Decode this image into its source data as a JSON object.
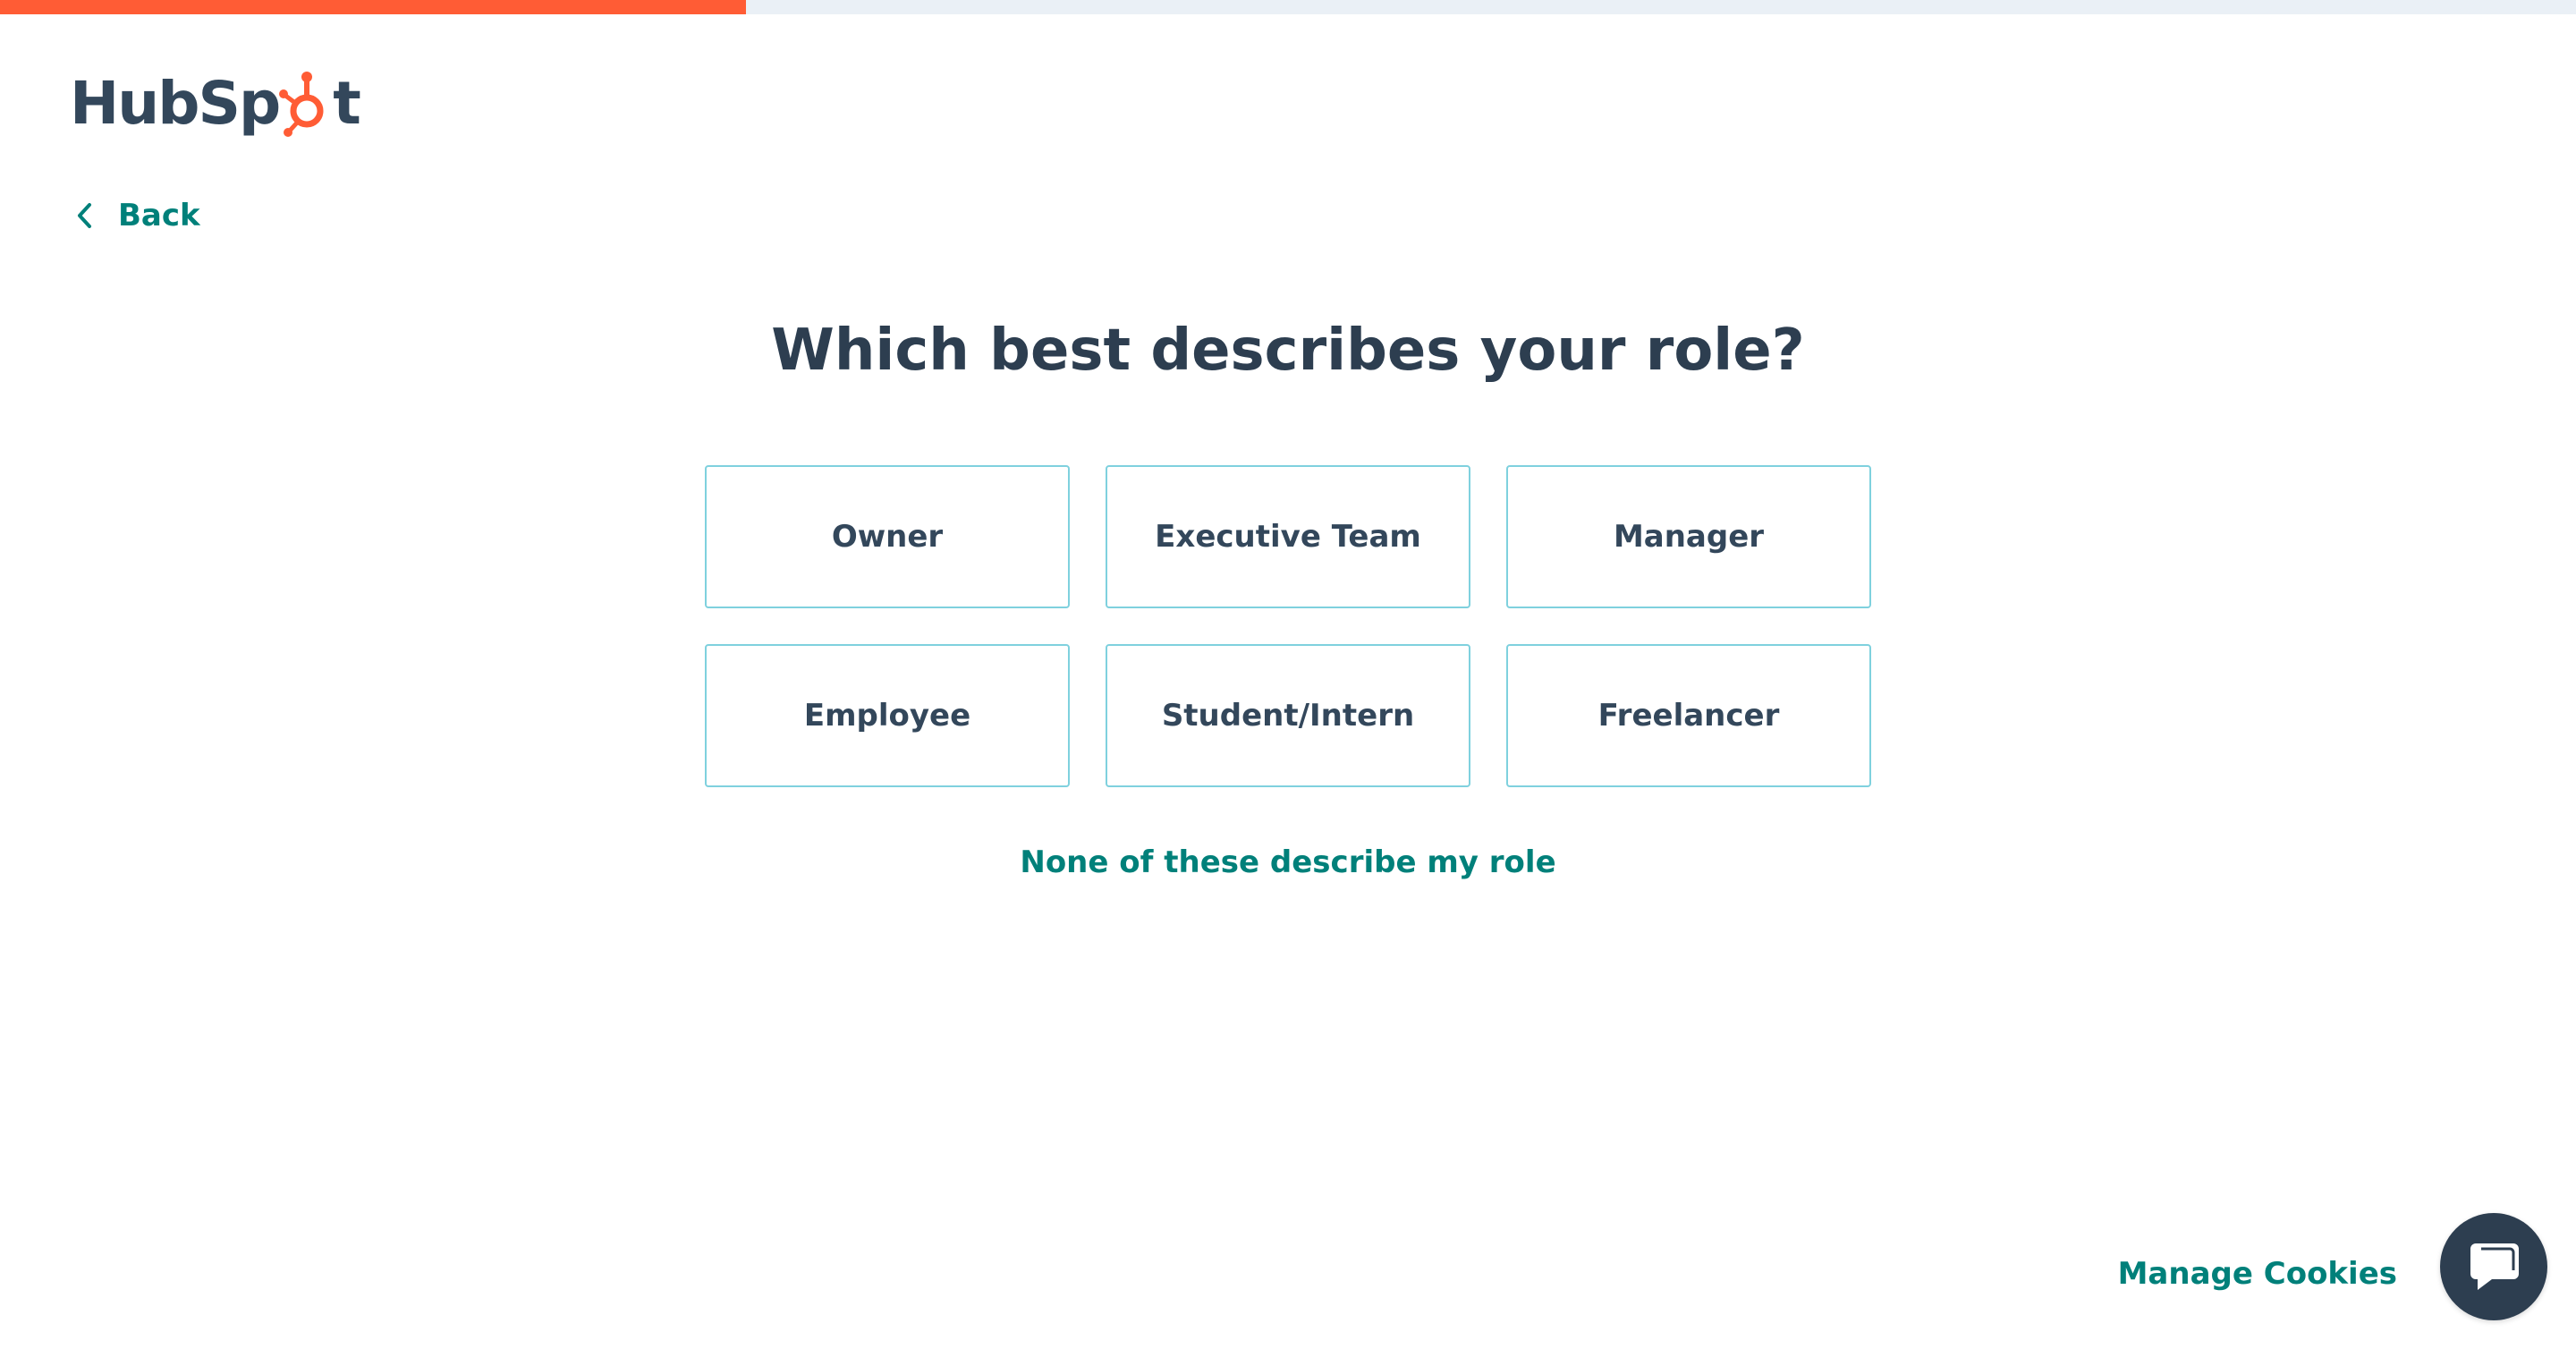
{
  "progress": {
    "fraction": 0.2896
  },
  "brand": {
    "logo_prefix": "HubSp",
    "logo_suffix": "t",
    "accent": "#ff5c35",
    "link_color": "#00807a",
    "heading_color": "#2d3e50",
    "option_border": "#7fd1de"
  },
  "nav": {
    "back_label": "Back",
    "back_icon": "chevron-left-icon"
  },
  "question": {
    "title": "Which best describes your role?",
    "options": [
      {
        "label": "Owner"
      },
      {
        "label": "Executive Team"
      },
      {
        "label": "Manager"
      },
      {
        "label": "Employee"
      },
      {
        "label": "Student/Intern"
      },
      {
        "label": "Freelancer"
      }
    ],
    "none_label": "None of these describe my role"
  },
  "footer": {
    "manage_cookies_label": "Manage Cookies",
    "chat_icon": "chat-bubble-icon"
  }
}
